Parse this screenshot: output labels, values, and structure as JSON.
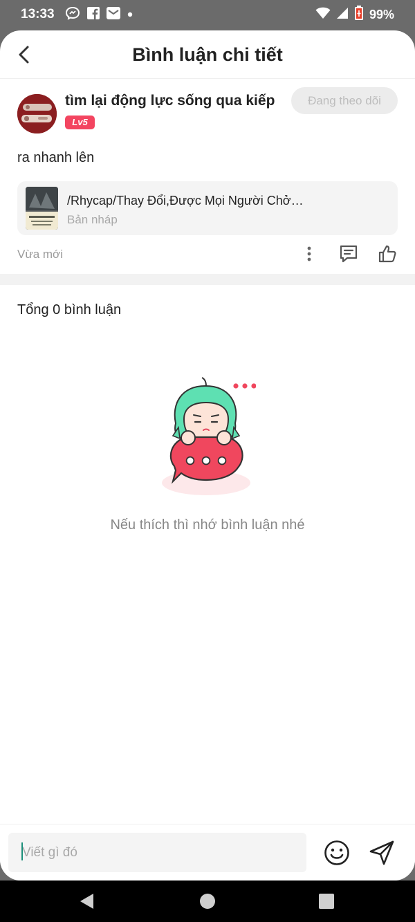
{
  "status_bar": {
    "time": "13:33",
    "battery": "99%",
    "icons": [
      "messenger-icon",
      "facebook-icon",
      "email-icon",
      "dot-icon",
      "wifi-icon",
      "signal-icon",
      "battery-icon"
    ]
  },
  "header": {
    "title": "Bình luận chi tiết",
    "back_icon": "back-arrow-icon"
  },
  "comment": {
    "author_name": "tìm lại động lực sống qua kiếp",
    "level": "Lv5",
    "follow_label": "Đang theo dõi",
    "text": "ra nhanh lên",
    "time": "Vừa mới",
    "story": {
      "title": "/Rhycap/Thay Đổi,Được Mọi Người Chở…",
      "status": "Bản nháp"
    },
    "actions": [
      "more-icon",
      "reply-icon",
      "like-icon"
    ]
  },
  "comments_section": {
    "total_label": "Tổng 0 bình luận",
    "empty_text": "Nếu thích thì nhớ bình luận nhé"
  },
  "input": {
    "placeholder": "Viết gì đó",
    "icons": [
      "emoji-icon",
      "send-icon"
    ]
  },
  "nav": [
    "back-triangle-icon",
    "home-circle-icon",
    "recents-square-icon"
  ],
  "colors": {
    "accent": "#f34560",
    "status_bar": "#6b6b6b",
    "illustration_hair": "#5ee0b2",
    "illustration_bubble": "#f0475e"
  }
}
